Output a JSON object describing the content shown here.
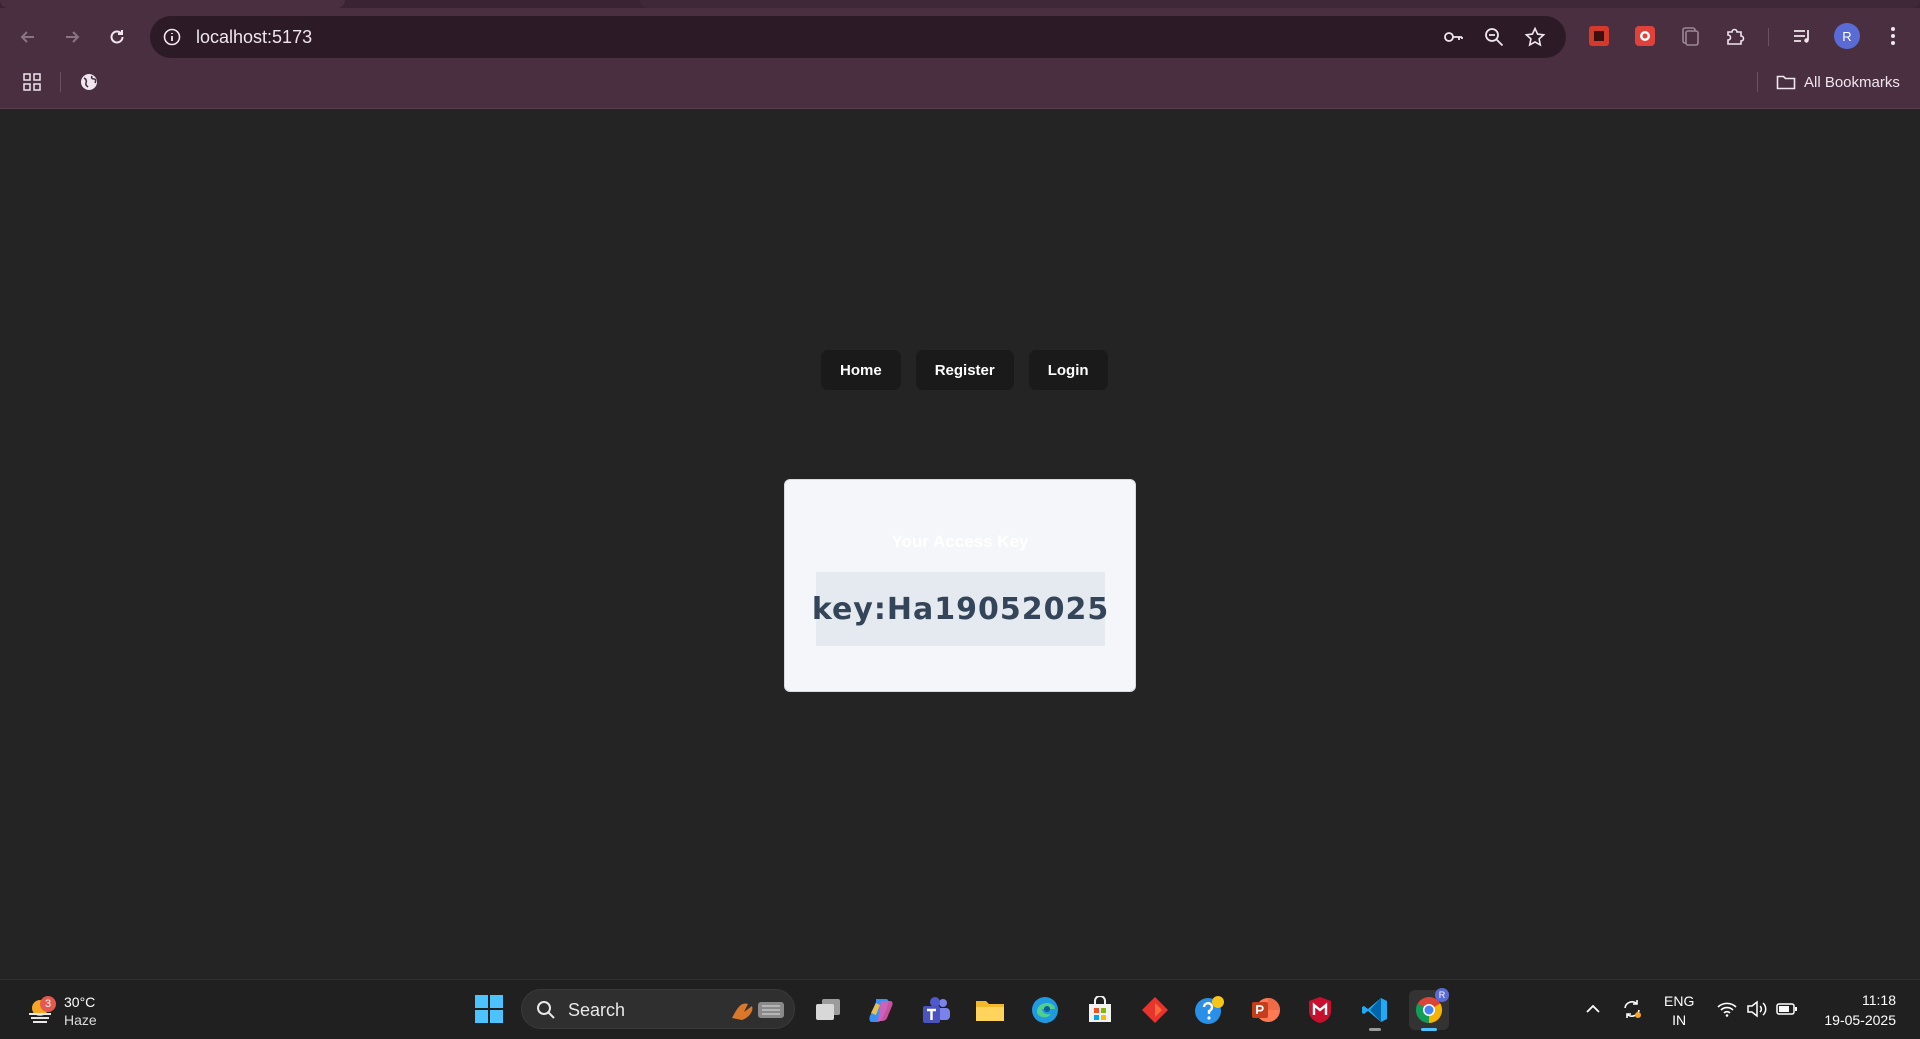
{
  "browser": {
    "url": "localhost:5173",
    "profile_initial": "R",
    "bookmarks_label": "All Bookmarks"
  },
  "page": {
    "nav": [
      "Home",
      "Register",
      "Login"
    ],
    "card": {
      "title": "Your Access Key",
      "key": "key:Ha19052025"
    }
  },
  "taskbar": {
    "weather": {
      "temp": "30°C",
      "condition": "Haze",
      "badge": "3"
    },
    "search_label": "Search",
    "apps": [
      "task-view",
      "copilot",
      "teams",
      "file-explorer",
      "edge",
      "microsoft-store",
      "git-app",
      "get-help",
      "powerpoint",
      "mcafee",
      "vscode",
      "chrome"
    ],
    "language": {
      "line1": "ENG",
      "line2": "IN"
    },
    "time": "11:18",
    "date": "19-05-2025",
    "profile_badge": "R"
  }
}
